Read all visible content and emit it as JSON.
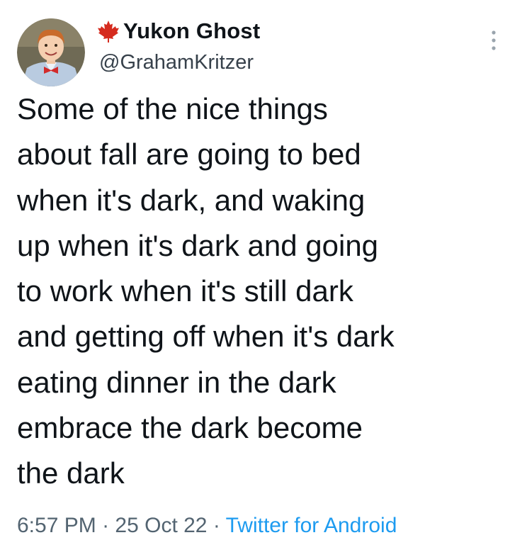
{
  "tweet": {
    "author": {
      "display_name": "Yukon Ghost",
      "handle": "@GrahamKritzer",
      "avatar_icon": "child-portrait-avatar",
      "flag_icon": "maple-leaf-icon",
      "flag_color": "#d52b1e"
    },
    "more_icon": "vertical-ellipsis-icon",
    "text_lines": [
      "Some of the nice things",
      "about fall are going to bed",
      "when it's dark, and waking",
      "up when it's dark and going",
      "to work when it's still dark",
      "and getting off when it's dark",
      "eating dinner in the dark",
      "embrace the dark become",
      "the dark"
    ],
    "meta": {
      "time": "6:57 PM",
      "separator": " · ",
      "date": "25 Oct 22",
      "source": "Twitter for Android"
    },
    "colors": {
      "text": "#0f1419",
      "secondary": "#536471",
      "link": "#1d9bf0"
    }
  }
}
